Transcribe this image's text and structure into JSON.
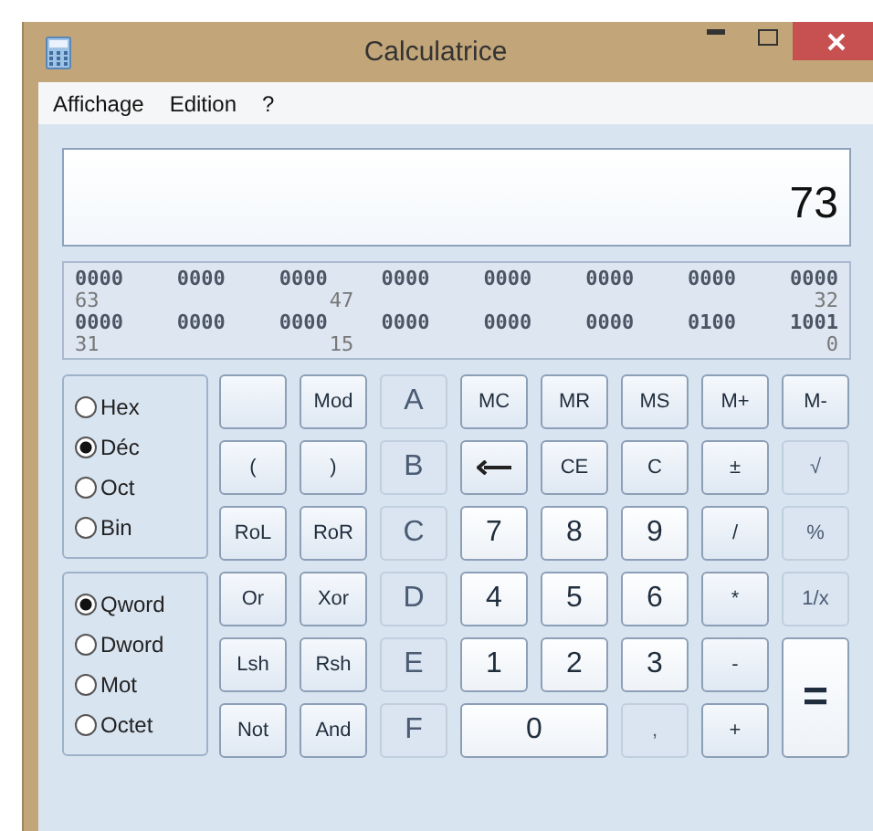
{
  "window": {
    "title": "Calculatrice"
  },
  "menu": [
    "Affichage",
    "Edition",
    "?"
  ],
  "display": {
    "value": "73"
  },
  "bits": [
    {
      "groups": [
        "0000",
        "0000",
        "0000",
        "0000",
        "0000",
        "0000",
        "0000",
        "0000"
      ],
      "marks": [
        "63",
        "47",
        "32"
      ]
    },
    {
      "groups": [
        "0000",
        "0000",
        "0000",
        "0000",
        "0000",
        "0000",
        "0100",
        "1001"
      ],
      "marks": [
        "31",
        "15",
        "0"
      ]
    }
  ],
  "base": [
    {
      "label": "Hex",
      "selected": false
    },
    {
      "label": "Déc",
      "selected": true
    },
    {
      "label": "Oct",
      "selected": false
    },
    {
      "label": "Bin",
      "selected": false
    }
  ],
  "word_size": [
    {
      "label": "Qword",
      "selected": true
    },
    {
      "label": "Dword",
      "selected": false
    },
    {
      "label": "Mot",
      "selected": false
    },
    {
      "label": "Octet",
      "selected": false
    }
  ],
  "keys": [
    {
      "kind": "blank",
      "disabled": false
    },
    {
      "kind": "op",
      "label": "Mod",
      "disabled": false
    },
    {
      "kind": "digit",
      "label": "A",
      "disabled": true
    },
    {
      "kind": "op",
      "label": "MC",
      "disabled": false
    },
    {
      "kind": "op",
      "label": "MR",
      "disabled": false
    },
    {
      "kind": "op",
      "label": "MS",
      "disabled": false
    },
    {
      "kind": "op",
      "label": "M+",
      "disabled": false
    },
    {
      "kind": "op",
      "label": "M-",
      "disabled": false
    },
    {
      "kind": "op",
      "label": "(",
      "disabled": false
    },
    {
      "kind": "op",
      "label": ")",
      "disabled": false
    },
    {
      "kind": "digit",
      "label": "B",
      "disabled": true
    },
    {
      "kind": "backspace",
      "disabled": false
    },
    {
      "kind": "op",
      "label": "CE",
      "disabled": false
    },
    {
      "kind": "op",
      "label": "C",
      "disabled": false
    },
    {
      "kind": "op",
      "label": "±",
      "disabled": false
    },
    {
      "kind": "op",
      "label": "√",
      "disabled": true
    },
    {
      "kind": "op",
      "label": "RoL",
      "disabled": false
    },
    {
      "kind": "op",
      "label": "RoR",
      "disabled": false
    },
    {
      "kind": "digit",
      "label": "C",
      "disabled": true
    },
    {
      "kind": "digit",
      "label": "7",
      "disabled": false
    },
    {
      "kind": "digit",
      "label": "8",
      "disabled": false
    },
    {
      "kind": "digit",
      "label": "9",
      "disabled": false
    },
    {
      "kind": "op",
      "label": "/",
      "disabled": false
    },
    {
      "kind": "op",
      "label": "%",
      "disabled": true
    },
    {
      "kind": "op",
      "label": "Or",
      "disabled": false
    },
    {
      "kind": "op",
      "label": "Xor",
      "disabled": false
    },
    {
      "kind": "digit",
      "label": "D",
      "disabled": true
    },
    {
      "kind": "digit",
      "label": "4",
      "disabled": false
    },
    {
      "kind": "digit",
      "label": "5",
      "disabled": false
    },
    {
      "kind": "digit",
      "label": "6",
      "disabled": false
    },
    {
      "kind": "op",
      "label": "*",
      "disabled": false
    },
    {
      "kind": "op",
      "label": "1/x",
      "disabled": true
    },
    {
      "kind": "op",
      "label": "Lsh",
      "disabled": false
    },
    {
      "kind": "op",
      "label": "Rsh",
      "disabled": false
    },
    {
      "kind": "digit",
      "label": "E",
      "disabled": true
    },
    {
      "kind": "digit",
      "label": "1",
      "disabled": false
    },
    {
      "kind": "digit",
      "label": "2",
      "disabled": false
    },
    {
      "kind": "digit",
      "label": "3",
      "disabled": false
    },
    {
      "kind": "op",
      "label": "-",
      "disabled": false
    },
    {
      "kind": "equals",
      "label": "=",
      "disabled": false
    },
    {
      "kind": "op",
      "label": "Not",
      "disabled": false
    },
    {
      "kind": "op",
      "label": "And",
      "disabled": false
    },
    {
      "kind": "digit",
      "label": "F",
      "disabled": true
    },
    {
      "kind": "zero",
      "label": "0",
      "disabled": false
    },
    {
      "kind": "op",
      "label": ",",
      "disabled": true
    },
    {
      "kind": "op",
      "label": "+",
      "disabled": false
    }
  ]
}
